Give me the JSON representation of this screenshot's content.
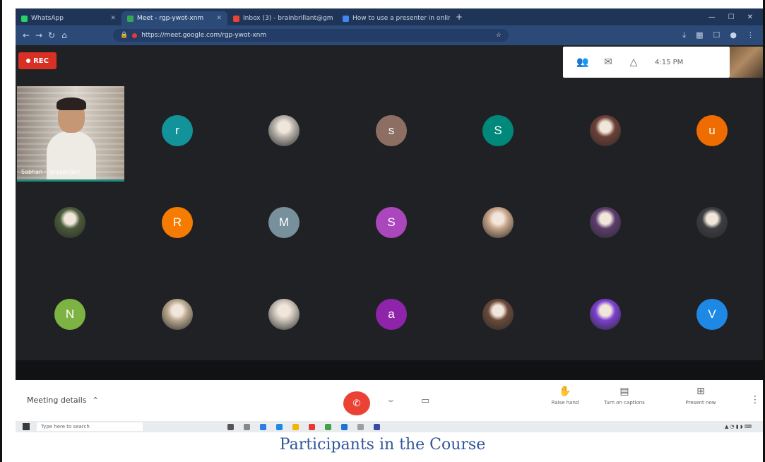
{
  "browser": {
    "tabs": [
      {
        "label": "WhatsApp"
      },
      {
        "label": "Meet - rgp-ywot-xnm"
      },
      {
        "label": "Inbox (3) - brainbrillant@gm"
      },
      {
        "label": "How to use a presenter in online..."
      }
    ],
    "url": "https://meet.google.com/rgp-ywot-xnm"
  },
  "meet": {
    "rec_label": "REC",
    "clock": "4:15 PM",
    "speaker_name": "Sabhan - (presenter)",
    "participants": [
      {
        "label": "r",
        "color": "#12939a"
      },
      {
        "label": "",
        "color": "#b7b2ab"
      },
      {
        "label": "s",
        "color": "#8d6e63"
      },
      {
        "label": "S",
        "color": "#00897b"
      },
      {
        "label": "",
        "color": "#6d4036"
      },
      {
        "label": "u",
        "color": "#ef6c00"
      },
      {
        "label": "",
        "color": "#4a5b3a"
      },
      {
        "label": "R",
        "color": "#f57c00"
      },
      {
        "label": "M",
        "color": "#78909c"
      },
      {
        "label": "S",
        "color": "#ab47bc"
      },
      {
        "label": "",
        "color": "#c8a58a"
      },
      {
        "label": "",
        "color": "#5c3c6e"
      },
      {
        "label": "",
        "color": "#3d3d42"
      },
      {
        "label": "N",
        "color": "#7cb342"
      },
      {
        "label": "",
        "color": "#b9a88f"
      },
      {
        "label": "",
        "color": "#c9c1b7"
      },
      {
        "label": "a",
        "color": "#8e24aa"
      },
      {
        "label": "",
        "color": "#6a4a3a"
      },
      {
        "label": "",
        "color": "#7b3fd0"
      },
      {
        "label": "V",
        "color": "#1e88e5"
      }
    ],
    "meeting_details": "Meeting details",
    "actions": [
      {
        "label": "Raise hand"
      },
      {
        "label": "Turn on captions"
      },
      {
        "label": "Present now"
      }
    ]
  },
  "taskbar": {
    "search_placeholder": "Type here to search"
  },
  "caption": "Participants in the Course"
}
